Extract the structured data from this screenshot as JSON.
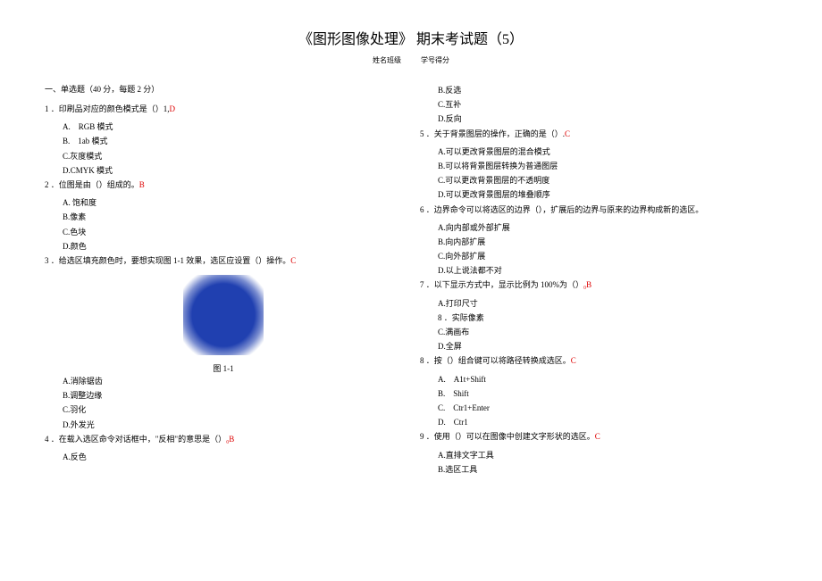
{
  "title": "《图形图像处理》 期末考试题（5）",
  "subtitle": {
    "left": "姓名班级",
    "right": "学号得分"
  },
  "section_title": "一、单选题（40 分，每题 2 分）",
  "left_col": {
    "q1": {
      "stem": "1 ．印刷品对应的颜色模式是（）1,",
      "answer": "D",
      "opts": [
        "A.　RGB 模式",
        "B.　1ab 模式",
        "C.灰度模式",
        "D.CMYK 模式"
      ]
    },
    "q2": {
      "stem": "2 ．位图是由（）组成的。",
      "answer": "B",
      "opts": [
        "A. 饱和度",
        "B.像素",
        "C.色块",
        "D.颜色"
      ]
    },
    "q3": {
      "stem": "3 ．给选区填充颜色时，要想实现图 1-1 效果，选区应设置（）操作。",
      "answer": "C",
      "figure_caption": "图 1-1",
      "opts": [
        "A.消除锯齿",
        "B.调整边缘",
        "C.羽化",
        "D.外发光"
      ]
    },
    "q4": {
      "stem": "4 ．在载入选区命令对话框中，\"反相\"的意思是（）",
      "answer": "₀B",
      "opts": [
        "A.反色"
      ]
    }
  },
  "right_col": {
    "q4_cont": [
      "B.反选",
      "C.互补",
      "D.反向"
    ],
    "q5": {
      "stem": "5 ．关于背景图层的操作，正确的是（）.",
      "answer": "C",
      "opts": [
        "A.可以更改背景图层的混合模式",
        "B.可以将背景图层转换为普通图层",
        "C.可以更改背景图层的不透明度",
        "D.可以更改背景图层的堆叠顺序"
      ]
    },
    "q6": {
      "stem": "6 ．边界命令可以将选区的边界（），扩展后的边界与原来的边界构成新的选区。",
      "answer": "",
      "opts": [
        "A.向内部或外部扩展",
        "B.向内部扩展",
        "C.向外部扩展",
        "D.以上说法都不对"
      ]
    },
    "q7": {
      "stem": "7 ．以下显示方式中，显示比例为 100%为（）",
      "answer": "₀B",
      "opts": [
        "A.打印尺寸",
        "8 ．实际像素",
        "C.满画布",
        "D.全屏"
      ]
    },
    "q8": {
      "stem": "8 ．按（）组合键可以将路径转换成选区。",
      "answer": "C",
      "opts": [
        "A.　A1t+Shift",
        "B.　Shift",
        "C.　Ctr1+Enter",
        "D.　Ctr1"
      ]
    },
    "q9": {
      "stem": "9 ．使用（）可以在图像中创建文字形状的选区。",
      "answer": "C",
      "opts": [
        "A.直排文字工具",
        "B.选区工具"
      ]
    }
  }
}
